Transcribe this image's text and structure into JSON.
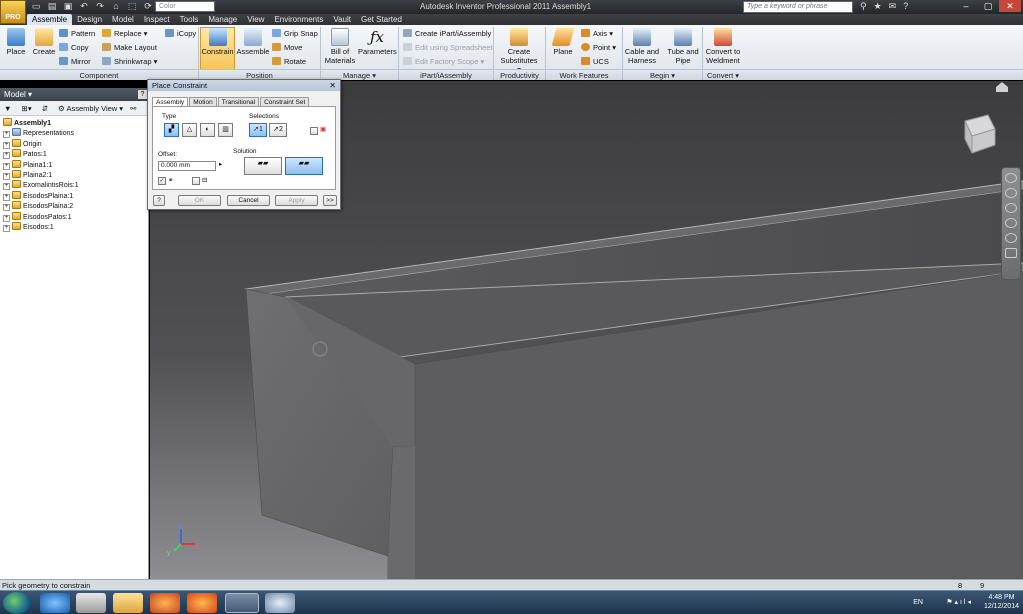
{
  "titlebar": {
    "app_button_label": "PRO",
    "color_placeholder": "Color",
    "window_title": "Autodesk Inventor Professional 2011    Assembly1",
    "search_placeholder": "Type a keyword or phrase"
  },
  "menu": [
    "Assemble",
    "Design",
    "Model",
    "Inspect",
    "Tools",
    "Manage",
    "View",
    "Environments",
    "Vault",
    "Get Started"
  ],
  "ribbon": {
    "component": {
      "place": "Place",
      "create": "Create",
      "pattern": "Pattern",
      "copy": "Copy",
      "mirror": "Mirror",
      "replace": "Replace",
      "make_layout": "Make Layout",
      "shrinkwrap": "Shrinkwrap",
      "icopy": "iCopy",
      "group": "Component"
    },
    "position": {
      "constrain": "Constrain",
      "assemble": "Assemble",
      "grip_snap": "Grip Snap",
      "move": "Move",
      "rotate": "Rotate",
      "group": "Position"
    },
    "manage": {
      "bom": "Bill of Materials",
      "parameters": "Parameters",
      "group": "Manage"
    },
    "ipart": {
      "create_ipart": "Create iPart/iAssembly",
      "edit_spreadsheet": "Edit using Spreadsheet",
      "edit_factory": "Edit Factory Scope",
      "group": "iPart/iAssembly"
    },
    "productivity": {
      "create_substitutes": "Create Substitutes",
      "group": "Productivity"
    },
    "work_features": {
      "plane": "Plane",
      "axis": "Axis",
      "point": "Point",
      "ucs": "UCS",
      "group": "Work Features"
    },
    "begin": {
      "cable_harness": "Cable and Harness",
      "tube_pipe": "Tube and Pipe",
      "group": "Begin"
    },
    "convert": {
      "weldment": "Convert to Weldment",
      "group": "Convert"
    }
  },
  "model_panel": {
    "title": "Model",
    "help": "?",
    "view_label": "Assembly View",
    "tree": [
      "Assembly1",
      "Representations",
      "Origin",
      "Patos:1",
      "Plaina1:1",
      "Plaina2:1",
      "ExomalintisRois:1",
      "EisodosPlaina:1",
      "EisodosPlaina:2",
      "EisodosPatos:1",
      "Eisodos:1"
    ]
  },
  "dialog": {
    "title": "Place Constraint",
    "tabs": [
      "Assembly",
      "Motion",
      "Transitional",
      "Constraint Set"
    ],
    "type_label": "Type",
    "selections_label": "Selections",
    "offset_label": "Offset:",
    "offset_value": "0.000 mm",
    "solution_label": "Solution",
    "sel1": "1",
    "sel2": "2",
    "help": "?",
    "ok": "OK",
    "cancel": "Cancel",
    "apply": "Apply",
    "more": ">>"
  },
  "status": {
    "message": "Pick geometry to constrain",
    "n1": "8",
    "n2": "9"
  },
  "tray": {
    "lang": "EN",
    "time": "4:48 PM",
    "date": "12/12/2014"
  },
  "colors": {
    "ribbon_bg": "#e8ecf1",
    "titlebar": "#2f3135",
    "viewport_top": "#3c3c3e",
    "viewport_bottom": "#8e8e92",
    "active_tool": "#f7c55d"
  }
}
